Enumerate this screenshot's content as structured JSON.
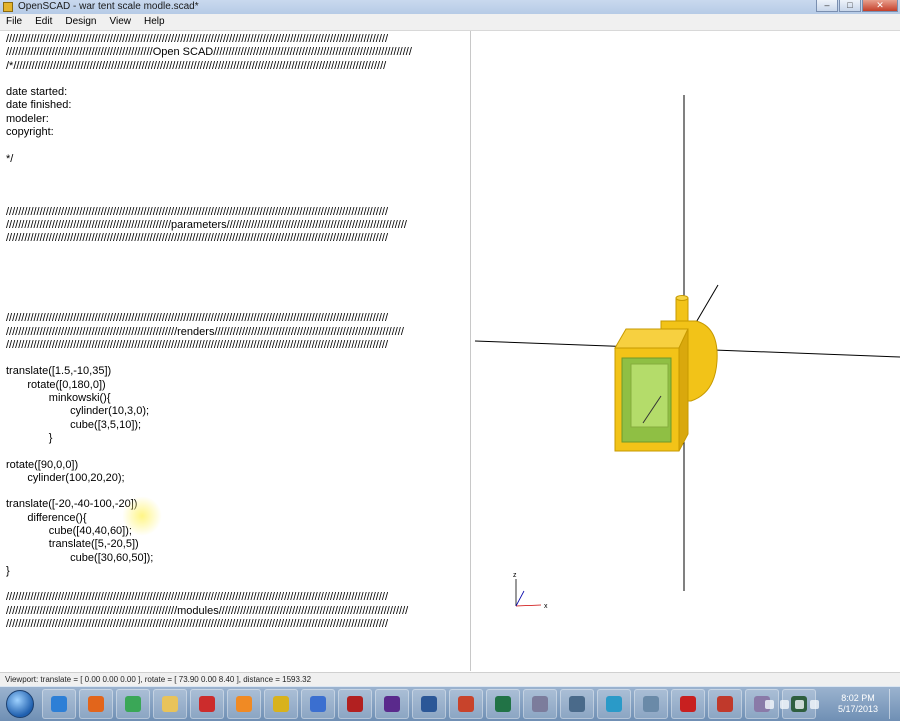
{
  "window": {
    "title": "OpenSCAD - war tent scale modle.scad*",
    "controls": {
      "minimize": "–",
      "maximize": "□",
      "close": "✕"
    }
  },
  "menu": [
    "File",
    "Edit",
    "Design",
    "View",
    "Help"
  ],
  "editor": {
    "lines": [
      "/////////////////////////////////////////////////////////////////////////////////////////////////////////////////////////////",
      "////////////////////////////////////////////////Open SCAD/////////////////////////////////////////////////////////////////",
      "/*//////////////////////////////////////////////////////////////////////////////////////////////////////////////////////////",
      "",
      "date started:",
      "date finished:",
      "modeler:",
      "copyright:",
      "",
      "*/",
      "",
      "",
      "",
      "/////////////////////////////////////////////////////////////////////////////////////////////////////////////////////////////",
      "//////////////////////////////////////////////////////parameters///////////////////////////////////////////////////////////",
      "/////////////////////////////////////////////////////////////////////////////////////////////////////////////////////////////",
      "",
      "",
      "",
      "",
      "",
      "/////////////////////////////////////////////////////////////////////////////////////////////////////////////////////////////",
      "////////////////////////////////////////////////////////renders//////////////////////////////////////////////////////////////",
      "/////////////////////////////////////////////////////////////////////////////////////////////////////////////////////////////",
      "",
      "translate([1.5,-10,35])",
      "       rotate([0,180,0])",
      "              minkowski(){",
      "                     cylinder(10,3,0);",
      "                     cube([3,5,10]);",
      "              }",
      "",
      "rotate([90,0,0])",
      "       cylinder(100,20,20);",
      "",
      "translate([-20,-40-100,-20])",
      "       difference(){",
      "              cube([40,40,60]);",
      "              translate([5,-20,5])",
      "                     cube([30,60,50]);",
      "}",
      "",
      "/////////////////////////////////////////////////////////////////////////////////////////////////////////////////////////////",
      "////////////////////////////////////////////////////////modules//////////////////////////////////////////////////////////////",
      "/////////////////////////////////////////////////////////////////////////////////////////////////////////////////////////////"
    ]
  },
  "viewport": {
    "axis_labels": {
      "z": "z",
      "x": "x"
    },
    "colors": {
      "model_face": "#f2c318",
      "model_edge": "#c79a00",
      "inner_face": "#9ccc4c",
      "axis": "#000000"
    }
  },
  "status": "Viewport: translate = [ 0.00 0.00 0.00 ], rotate = [ 73.90 0.00 8.40 ], distance = 1593.32",
  "taskbar": {
    "apps": [
      {
        "name": "ie",
        "color": "#2d7fd6"
      },
      {
        "name": "firefox",
        "color": "#e2651b"
      },
      {
        "name": "chrome",
        "color": "#3aa757"
      },
      {
        "name": "explorer",
        "color": "#e8c35a"
      },
      {
        "name": "app-red",
        "color": "#cc2c2c"
      },
      {
        "name": "blender",
        "color": "#f08a24"
      },
      {
        "name": "openscad",
        "color": "#d8b21c"
      },
      {
        "name": "ccleaner",
        "color": "#3b6fd0"
      },
      {
        "name": "rhino",
        "color": "#b22020"
      },
      {
        "name": "visual-studio",
        "color": "#5a2a8c"
      },
      {
        "name": "word",
        "color": "#2b5797"
      },
      {
        "name": "powerpoint",
        "color": "#c8432b"
      },
      {
        "name": "excel",
        "color": "#217346"
      },
      {
        "name": "app-clock",
        "color": "#7c7c9c"
      },
      {
        "name": "app-tools",
        "color": "#4a6a8a"
      },
      {
        "name": "app-screen",
        "color": "#2a9ac8"
      },
      {
        "name": "app-photo",
        "color": "#6a8aa8"
      },
      {
        "name": "app-red2",
        "color": "#c82020"
      },
      {
        "name": "flash",
        "color": "#c0392b"
      },
      {
        "name": "app-misc",
        "color": "#8a7aa8"
      },
      {
        "name": "terminal",
        "color": "#2e5e3e"
      }
    ],
    "time": "8:02 PM",
    "date": "5/17/2013"
  }
}
